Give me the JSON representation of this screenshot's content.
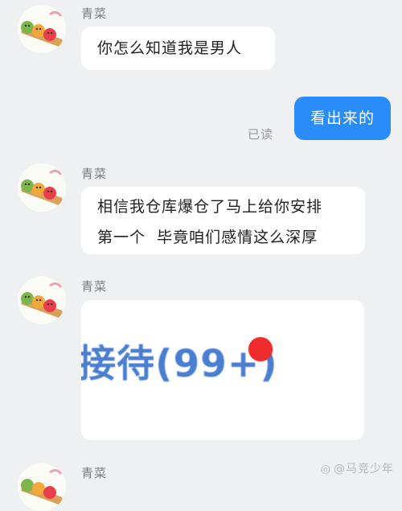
{
  "messages": [
    {
      "sender": "青菜",
      "text": "你怎么知道我是男人"
    },
    {
      "reply": "看出来的",
      "status": "已读"
    },
    {
      "sender": "青菜",
      "line1": "相信我仓库爆仓了马上给你安排",
      "line2": "第一个  毕竟咱们感情这么深厚"
    },
    {
      "sender": "青菜",
      "image_text": "接待(99+)"
    },
    {
      "sender": "青菜"
    }
  ],
  "colors": {
    "outgoing_bubble": "#2a8cf8",
    "background": "#eff0f2",
    "badge_red": "#ef2c2c"
  },
  "icons": {
    "avatar": "cartoon-food-avatar-icon",
    "badge": "notification-dot-icon",
    "watermark": "weibo-logo-icon"
  },
  "watermark": "@马竞少年"
}
